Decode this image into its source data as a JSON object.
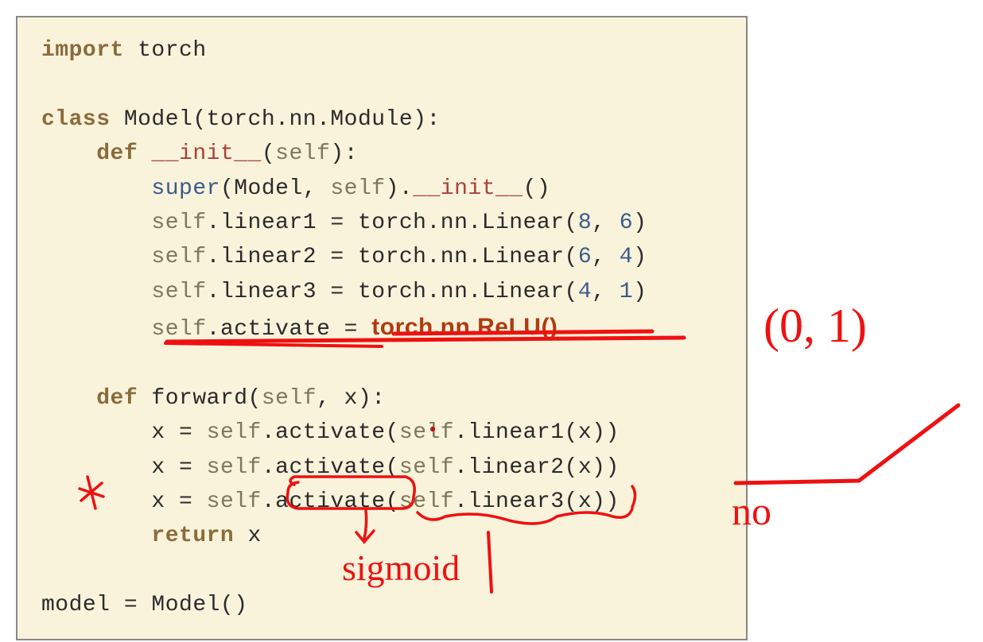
{
  "code": {
    "l1_kw": "import",
    "l1_rest": " torch",
    "l3_kw": "class",
    "l3_name": " Model",
    "l3_rest": "(torch.nn.Module):",
    "l4_kw": "    def",
    "l4_fn": " __init__",
    "l4_open": "(",
    "l4_self": "self",
    "l4_close": "):",
    "l5_call1": "        super",
    "l5_mid": "(Model, ",
    "l5_self": "self",
    "l5_dot": ").",
    "l5_fn": "__init__",
    "l5_end": "()",
    "l6_pre": "        ",
    "l6_self": "self",
    "l6_mid": ".linear1 = torch.nn.Linear(",
    "l6_n1": "8",
    "l6_comma": ", ",
    "l6_n2": "6",
    "l6_close": ")",
    "l7_pre": "        ",
    "l7_self": "self",
    "l7_mid": ".linear2 = torch.nn.Linear(",
    "l7_n1": "6",
    "l7_comma": ", ",
    "l7_n2": "4",
    "l7_close": ")",
    "l8_pre": "        ",
    "l8_self": "self",
    "l8_mid": ".linear3 = torch.nn.Linear(",
    "l8_n1": "4",
    "l8_comma": ", ",
    "l8_n2": "1",
    "l8_close": ")",
    "l9_pre": "        ",
    "l9_self": "self",
    "l9_mid": ".activate = ",
    "l9_relu": "torch.nn.ReLU()",
    "l11_kw": "    def",
    "l11_fn": " forward",
    "l11_open": "(",
    "l11_self": "self",
    "l11_mid": ", x):",
    "l12_pre": "        x = ",
    "l12_self1": "self",
    "l12_act": ".activate(",
    "l12_self2": "self",
    "l12_rest": ".linear1(x))",
    "l13_pre": "        x = ",
    "l13_self1": "self",
    "l13_act": ".activate(",
    "l13_self2": "self",
    "l13_rest": ".linear2(x))",
    "l14_pre": "        x = ",
    "l14_self1": "self",
    "l14_act": ".activate(",
    "l14_self2": "self",
    "l14_rest": ".linear3(x))",
    "l15_kw": "        return",
    "l15_rest": " x",
    "l17_plain": "model = Model()"
  },
  "annotations": {
    "sigmoid_label": "sigmoid",
    "range_label": "(0, 1)",
    "no_label": "no"
  }
}
